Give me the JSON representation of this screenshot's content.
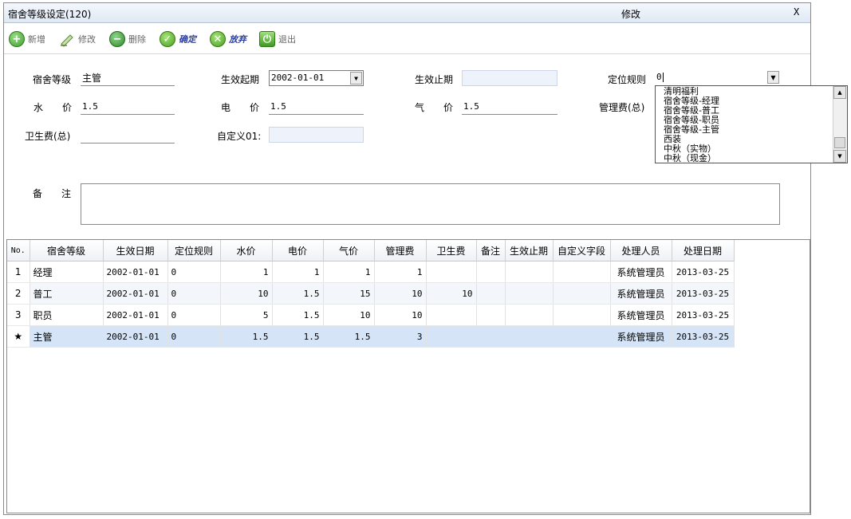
{
  "window": {
    "title": "宿舍等级设定(120)",
    "mode": "修改",
    "close": "X"
  },
  "toolbar": {
    "add": "新增",
    "edit": "修改",
    "delete": "删除",
    "confirm": "确定",
    "abandon": "放弃",
    "exit": "退出"
  },
  "form": {
    "level_label": "宿舍等级",
    "level_value": "主管",
    "start_label": "生效起期",
    "start_value": "2002-01-01",
    "end_label": "生效止期",
    "end_value": "",
    "rule_label": "定位规则",
    "rule_value": "0",
    "water_label": "水　　价",
    "water_value": "1.5",
    "elec_label": "电　　价",
    "elec_value": "1.5",
    "gas_label": "气　　价",
    "gas_value": "1.5",
    "mgmt_label": "管理费(总)",
    "sanit_label": "卫生费(总)",
    "sanit_value": "",
    "custom_label": "自定义01:",
    "custom_value": "",
    "remark_label": "备　　注",
    "remark_value": ""
  },
  "dropdown": {
    "options": [
      "清明福利",
      "宿舍等级-经理",
      "宿舍等级-普工",
      "宿舍等级-职员",
      "宿舍等级-主管",
      "西装",
      "中秋（实物）",
      "中秋（现金）"
    ]
  },
  "grid": {
    "columns": [
      "No.",
      "宿舍等级",
      "生效日期",
      "定位规则",
      "水价",
      "电价",
      "气价",
      "管理费",
      "卫生费",
      "备注",
      "生效止期",
      "自定义字段",
      "处理人员",
      "处理日期"
    ],
    "rows": [
      {
        "no": "1",
        "level": "经理",
        "date": "2002-01-01",
        "rule": "0",
        "water": "1",
        "elec": "1",
        "gas": "1",
        "mgmt": "1",
        "sanit": "",
        "remark": "",
        "end": "",
        "custom": "",
        "user": "系统管理员",
        "pdate": "2013-03-25"
      },
      {
        "no": "2",
        "level": "普工",
        "date": "2002-01-01",
        "rule": "0",
        "water": "10",
        "elec": "1.5",
        "gas": "15",
        "mgmt": "10",
        "sanit": "10",
        "remark": "",
        "end": "",
        "custom": "",
        "user": "系统管理员",
        "pdate": "2013-03-25"
      },
      {
        "no": "3",
        "level": "职员",
        "date": "2002-01-01",
        "rule": "0",
        "water": "5",
        "elec": "1.5",
        "gas": "10",
        "mgmt": "10",
        "sanit": "",
        "remark": "",
        "end": "",
        "custom": "",
        "user": "系统管理员",
        "pdate": "2013-03-25"
      },
      {
        "no": "★",
        "level": "主管",
        "date": "2002-01-01",
        "rule": "0",
        "water": "1.5",
        "elec": "1.5",
        "gas": "1.5",
        "mgmt": "3",
        "sanit": "",
        "remark": "",
        "end": "",
        "custom": "",
        "user": "系统管理员",
        "pdate": "2013-03-25"
      }
    ]
  },
  "colors": {
    "selected_row": "#d5e5f7",
    "alt_row": "#f3f6fb",
    "toolbar_blue": "#2b3f9e"
  }
}
